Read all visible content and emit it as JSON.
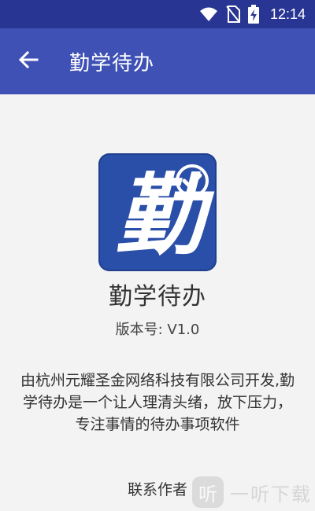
{
  "status_bar": {
    "time": "12:14",
    "icons": [
      "wifi-icon",
      "no-sim-icon",
      "battery-charging-icon"
    ]
  },
  "app_bar": {
    "back_icon": "arrow-back-icon",
    "title": "勤学待办"
  },
  "about": {
    "icon_glyph": "勤",
    "icon_badge": "checkmark-circle-icon",
    "app_name": "勤学待办",
    "version": "版本号: V1.0",
    "description": "由杭州元耀圣金网络科技有限公司开发,勤学待办是一个让人理清头绪，放下压力，专注事情的待办事项软件",
    "contact": "联系作者"
  },
  "watermark": {
    "logo_glyph": "听",
    "text": "一听下载"
  },
  "colors": {
    "status_bar": "#283593",
    "app_bar": "#3f51b5",
    "icon_bg": "#2a4fa8",
    "page_bg": "#f3f3f3"
  }
}
